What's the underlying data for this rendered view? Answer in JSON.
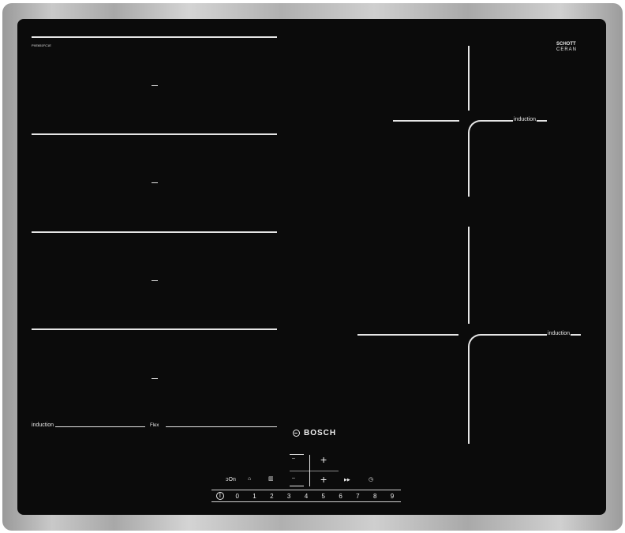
{
  "labels": {
    "model_code": "PXE651FC1E",
    "schott_line1": "SCHOTT",
    "schott_line2": "CERAN",
    "induction_right_top": "induction",
    "induction_right_bottom": "induction",
    "induction_left": "induction",
    "flexinduction_mark": "Flex",
    "brand": "BOSCH"
  },
  "controls": {
    "timer_minus": "–",
    "timer_minus2": "–",
    "plus_top": "+",
    "plus_bottom": "+",
    "cook_sensor": "ↄOn",
    "zone_select": "⌂",
    "lock": "▥",
    "power_boost": "▶▶",
    "timer": "◷"
  },
  "power_slider": {
    "power_symbol": "I",
    "levels": [
      "0",
      "1",
      "2",
      "3",
      "4",
      "5",
      "6",
      "7",
      "8",
      "9"
    ]
  }
}
